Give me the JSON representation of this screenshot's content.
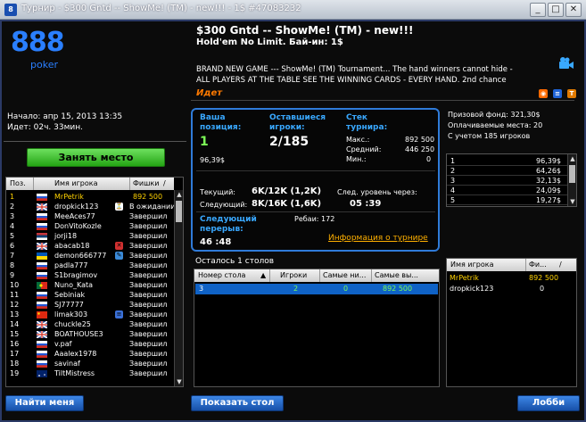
{
  "window": {
    "title": "Турнир - $300 Gntd -- ShowMe! (TM) - new!!! - 1$ #47083232",
    "minimize": "_",
    "maximize": "□",
    "close": "✕"
  },
  "logo": {
    "number": "888",
    "sub": "poker"
  },
  "tournament": {
    "name": "$300 Gntd -- ShowMe! (TM) - new!!!",
    "type": "Hold'em No Limit. Бай-ин: 1$",
    "desc_line1": "BRAND NEW  GAME --- ShowMe! (TM) Tournament... The hand winners cannot hide -",
    "desc_line2": "ALL PLAYERS AT THE TABLE SEE THE WINNING CARDS - EVERY HAND. 2nd chance",
    "status": "Идет",
    "start": "Начало: апр 15, 2013 13:35",
    "running": "Идет: 02ч. 33мин."
  },
  "buttons": {
    "take_seat": "Занять место",
    "find_me": "Найти меня",
    "show_table": "Показать стол",
    "lobby": "Лобби"
  },
  "players_table": {
    "headers": {
      "pos": "Поз.",
      "name": "Имя игрока",
      "chips": "Фишки"
    },
    "rows": [
      {
        "pos": "1",
        "name": "MrPetrik",
        "chips": "892 500",
        "flag": "ru",
        "highlight": true
      },
      {
        "pos": "2",
        "name": "dropkick123",
        "chips": "В ожидании",
        "flag": "gb"
      },
      {
        "pos": "3",
        "name": "MeeAces77",
        "chips": "Завершил",
        "flag": "ru"
      },
      {
        "pos": "4",
        "name": "DonVitoKozle",
        "chips": "Завершил",
        "flag": "ru"
      },
      {
        "pos": "5",
        "name": "jorji18",
        "chips": "Завершил",
        "flag": "rs"
      },
      {
        "pos": "6",
        "name": "abacab18",
        "chips": "Завершил",
        "flag": "gb"
      },
      {
        "pos": "7",
        "name": "demon666777",
        "chips": "Завершил",
        "flag": "ua"
      },
      {
        "pos": "8",
        "name": "padla777",
        "chips": "Завершил",
        "flag": "ru"
      },
      {
        "pos": "9",
        "name": "S1bragimov",
        "chips": "Завершил",
        "flag": "ru"
      },
      {
        "pos": "10",
        "name": "Nuno_Kata",
        "chips": "Завершил",
        "flag": "pt"
      },
      {
        "pos": "11",
        "name": "Sebiniak",
        "chips": "Завершил",
        "flag": "ru"
      },
      {
        "pos": "12",
        "name": "SJ77777",
        "chips": "Завершил",
        "flag": "ru"
      },
      {
        "pos": "13",
        "name": "limak303",
        "chips": "Завершил",
        "flag": "cn"
      },
      {
        "pos": "14",
        "name": "chuckle25",
        "chips": "Завершил",
        "flag": "gb"
      },
      {
        "pos": "15",
        "name": "BOATHOUSE3",
        "chips": "Завершил",
        "flag": "gb"
      },
      {
        "pos": "16",
        "name": "v.paf",
        "chips": "Завершил",
        "flag": "ru"
      },
      {
        "pos": "17",
        "name": "Aaalex1978",
        "chips": "Завершил",
        "flag": "ru"
      },
      {
        "pos": "18",
        "name": "savinaf",
        "chips": "Завершил",
        "flag": "ru"
      },
      {
        "pos": "19",
        "name": "TiltMistress",
        "chips": "Завершил",
        "flag": "au"
      }
    ]
  },
  "info": {
    "your_pos_label": "Ваша позиция:",
    "your_pos": "1",
    "remaining_label": "Оставшиеся игроки:",
    "remaining": "2/185",
    "stack_label": "Стек турнира:",
    "max_label": "Макс.:",
    "max": "892 500",
    "avg_label": "Средний:",
    "avg": "446 250",
    "min_label": "Мин.:",
    "min": "0",
    "pct": "96,39$",
    "current_label": "Текущий:",
    "current": "6K/12K (1,2K)",
    "next_label": "Следующий:",
    "next": "8K/16K (1,6K)",
    "next_level_label": "След. уровень через:",
    "next_level": "05 :39",
    "break_label": "Следующий перерыв:",
    "break": "46 :48",
    "rebuys": "Ребаи: 172",
    "info_link": "Информация о турнире"
  },
  "prize": {
    "fund": "Призовой фонд: 321,30$",
    "paid": "Оплачиваемые места: 20",
    "note": "С учетом 185 игроков",
    "rows": [
      {
        "place": "1",
        "amount": "96,39$"
      },
      {
        "place": "2",
        "amount": "64,26$"
      },
      {
        "place": "3",
        "amount": "32,13$"
      },
      {
        "place": "4",
        "amount": "24,09$"
      },
      {
        "place": "5",
        "amount": "19,27$"
      }
    ]
  },
  "tables": {
    "title": "Осталось 1 столов",
    "headers": {
      "num": "Номер стола",
      "players": "Игроки",
      "min": "Самые ни...",
      "max": "Самые вы..."
    },
    "rows": [
      {
        "num": "3",
        "players": "2",
        "min": "0",
        "max": "892 500"
      }
    ]
  },
  "table_players": {
    "headers": {
      "name": "Имя игрока",
      "chips": "Фи..."
    },
    "rows": [
      {
        "name": "MrPetrik",
        "chips": "892 500",
        "highlight": true
      },
      {
        "name": "dropkick123",
        "chips": "0"
      }
    ]
  }
}
